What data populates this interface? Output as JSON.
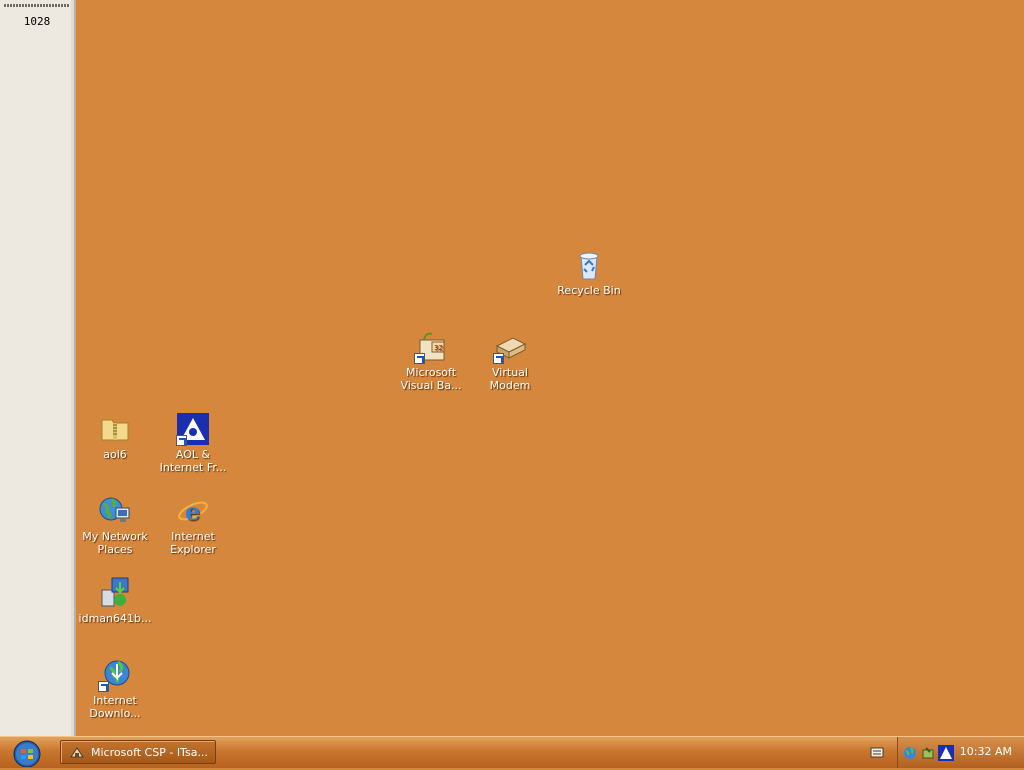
{
  "sidepanel": {
    "count": "1028"
  },
  "desktop": {
    "icons": [
      {
        "id": "recycle-bin",
        "label": "Recycle Bin"
      },
      {
        "id": "vb",
        "label": "Microsoft Visual Ba..."
      },
      {
        "id": "virtual-modem",
        "label": "Virtual Modem"
      },
      {
        "id": "aol6",
        "label": "aol6"
      },
      {
        "id": "aol-internet",
        "label": "AOL & Internet Fr..."
      },
      {
        "id": "network-places",
        "label": "My Network Places"
      },
      {
        "id": "internet-explorer",
        "label": "Internet Explorer"
      },
      {
        "id": "idman",
        "label": "idman641b..."
      },
      {
        "id": "internet-download",
        "label": "Internet Downlo..."
      }
    ]
  },
  "taskbar": {
    "start_icon": "windows-orb-icon",
    "task_button": "Microsoft CSP - ITsa...",
    "clock": "10:32 AM"
  },
  "colors": {
    "desktop": "#d6873e",
    "taskbar": "#c9762e"
  }
}
